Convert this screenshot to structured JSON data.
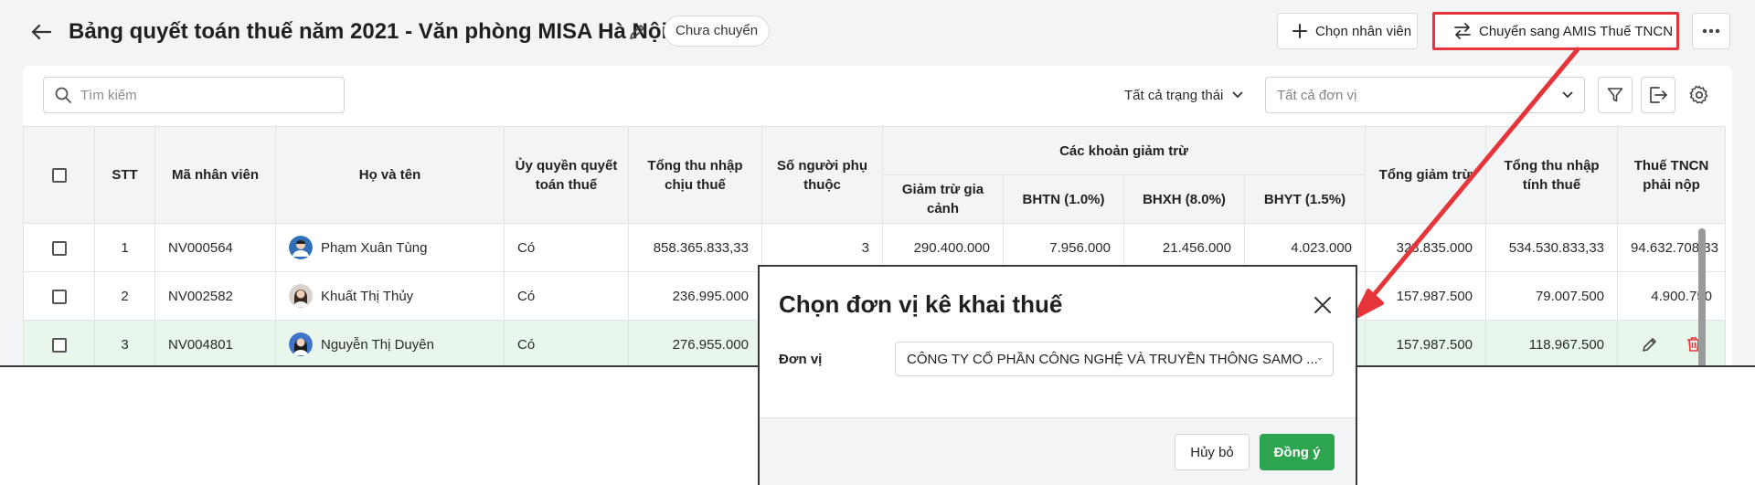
{
  "header": {
    "title": "Bảng quyết toán thuế năm 2021 - Văn phòng MISA Hà Nội",
    "status_badge": "Chưa chuyển",
    "choose_employee_label": "Chọn nhân viên",
    "transfer_label": "Chuyển sang AMIS Thuế TNCN"
  },
  "toolbar": {
    "search_placeholder": "Tìm kiếm",
    "status_filter": "Tất cả trạng thái",
    "unit_filter_placeholder": "Tất cả đơn vị"
  },
  "table": {
    "headers": {
      "stt": "STT",
      "employee_code": "Mã nhân viên",
      "full_name": "Họ và tên",
      "authorized": "Ủy quyền quyết toán thuế",
      "total_taxable_income": "Tổng thu nhập chịu thuế",
      "dependents": "Số người phụ thuộc",
      "deductions_group": "Các khoản giảm trừ",
      "family_deduction": "Giảm trừ gia cảnh",
      "bhtn": "BHTN (1.0%)",
      "bhxh": "BHXH (8.0%)",
      "bhyt": "BHYT (1.5%)",
      "total_deduction": "Tổng giảm trừ",
      "taxable_income": "Tổng thu nhập tính thuế",
      "tax_payable": "Thuế TNCN phải nộp"
    },
    "rows": [
      {
        "stt": "1",
        "code": "NV000564",
        "name": "Phạm Xuân Tùng",
        "authorized": "Có",
        "total_income": "858.365.833,33",
        "dependents": "3",
        "family": "290.400.000",
        "bhtn": "7.956.000",
        "bhxh": "21.456.000",
        "bhyt": "4.023.000",
        "total_deduction": "323.835.000",
        "taxable": "534.530.833,33",
        "tax": "94.632.708,33"
      },
      {
        "stt": "2",
        "code": "NV002582",
        "name": "Khuất Thị Thủy",
        "authorized": "Có",
        "total_income": "236.995.000",
        "dependents": "",
        "family": "",
        "bhtn": "",
        "bhxh": "",
        "bhyt": "",
        "total_deduction": "157.987.500",
        "taxable": "79.007.500",
        "tax": "4.900.750"
      },
      {
        "stt": "3",
        "code": "NV004801",
        "name": "Nguyễn Thị Duyên",
        "authorized": "Có",
        "total_income": "276.955.000",
        "dependents": "",
        "family": "",
        "bhtn": "",
        "bhxh": "",
        "bhyt": "",
        "total_deduction": "157.987.500",
        "taxable": "118.967.500",
        "tax": ""
      }
    ]
  },
  "dialog": {
    "title": "Chọn đơn vị kê khai thuế",
    "unit_label": "Đơn vị",
    "unit_value": "CÔNG TY CỔ PHẦN CÔNG NGHỆ VÀ TRUYỀN THÔNG SAMO  ...",
    "cancel_label": "Hủy bỏ",
    "ok_label": "Đồng ý"
  },
  "colors": {
    "accent_green": "#2da44e",
    "highlight_red": "#e5353b",
    "selected_row": "#e8f6ec",
    "delete_red": "#e5353b"
  }
}
